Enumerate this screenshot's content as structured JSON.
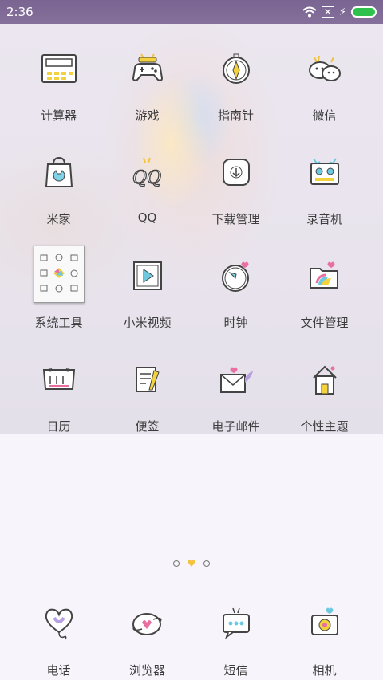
{
  "status_bar": {
    "time": "2:36",
    "icons": [
      "wifi-icon",
      "sim-error-icon",
      "charging-icon",
      "battery-icon"
    ],
    "battery_color": "#2ec14c"
  },
  "apps": [
    {
      "label": "计算器",
      "icon": "calculator-icon"
    },
    {
      "label": "游戏",
      "icon": "gamepad-icon"
    },
    {
      "label": "指南针",
      "icon": "compass-icon"
    },
    {
      "label": "微信",
      "icon": "wechat-icon"
    },
    {
      "label": "米家",
      "icon": "mijia-bag-icon"
    },
    {
      "label": "QQ",
      "icon": "qq-icon"
    },
    {
      "label": "下载管理",
      "icon": "download-icon"
    },
    {
      "label": "录音机",
      "icon": "recorder-icon"
    },
    {
      "label": "系统工具",
      "icon": "folder-icon"
    },
    {
      "label": "小米视频",
      "icon": "video-play-icon"
    },
    {
      "label": "时钟",
      "icon": "clock-icon"
    },
    {
      "label": "文件管理",
      "icon": "file-folder-icon"
    },
    {
      "label": "日历",
      "icon": "calendar-icon"
    },
    {
      "label": "便签",
      "icon": "notes-icon"
    },
    {
      "label": "电子邮件",
      "icon": "envelope-icon"
    },
    {
      "label": "个性主题",
      "icon": "house-theme-icon"
    }
  ],
  "page_indicator": {
    "pages": 3,
    "current": 2
  },
  "dock": [
    {
      "label": "电话",
      "icon": "heart-phone-icon"
    },
    {
      "label": "浏览器",
      "icon": "browser-icon"
    },
    {
      "label": "短信",
      "icon": "message-bubble-icon"
    },
    {
      "label": "相机",
      "icon": "camera-icon"
    }
  ]
}
